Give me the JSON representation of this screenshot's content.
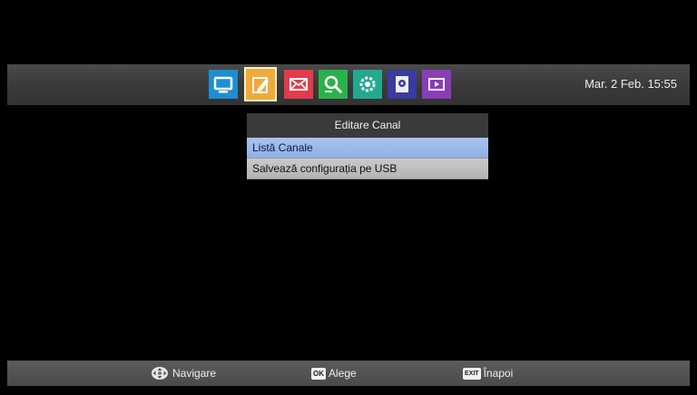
{
  "top_bar": {
    "menu_icons": [
      {
        "name": "tv-icon",
        "color": "#1e8fd0"
      },
      {
        "name": "edit-icon",
        "color": "#f2a93b",
        "selected": true
      },
      {
        "name": "mail-icon",
        "color": "#e33b4a"
      },
      {
        "name": "search-icon",
        "color": "#2bb14b"
      },
      {
        "name": "settings-icon",
        "color": "#23a98f"
      },
      {
        "name": "media-icon",
        "color": "#3a3aa0"
      },
      {
        "name": "play-icon",
        "color": "#8a3db6"
      }
    ],
    "datetime": "Mar. 2 Feb. 15:55"
  },
  "submenu": {
    "title": "Editare Canal",
    "items": [
      {
        "label": "Listă Canale",
        "highlighted": true
      },
      {
        "label": "Salvează configurația pe USB",
        "highlighted": false
      }
    ]
  },
  "bottom_bar": {
    "navigate_label": "Navigare",
    "ok_key": "OK",
    "ok_label": "Alege",
    "exit_key": "EXIT",
    "exit_label": "Înapoi"
  }
}
